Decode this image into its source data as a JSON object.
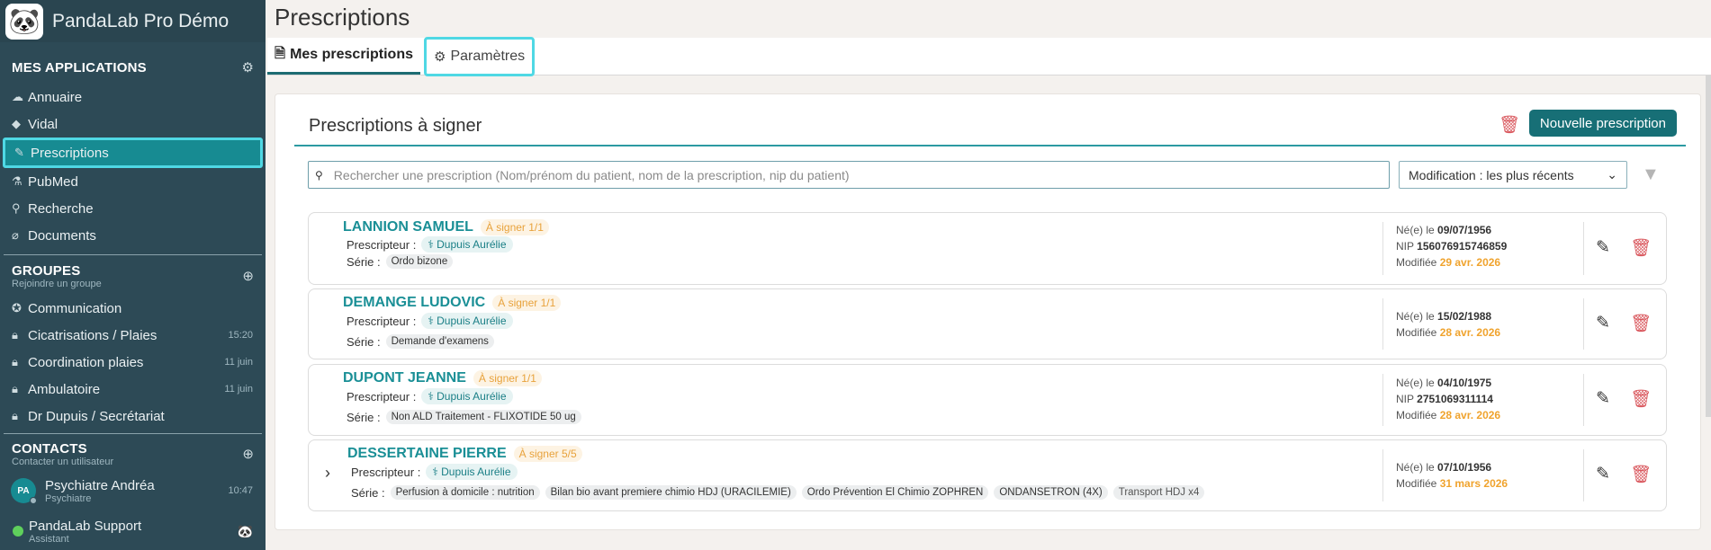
{
  "app": {
    "name": "PandaLab Pro Démo",
    "logo_icon": "panda-logo-icon"
  },
  "sidebar": {
    "apps_title": "MES APPLICATIONS",
    "apps": [
      {
        "label": "Annuaire",
        "icon": "cloud-icon"
      },
      {
        "label": "Vidal",
        "icon": "pill-icon"
      },
      {
        "label": "Prescriptions",
        "icon": "prescription-icon",
        "active": true
      },
      {
        "label": "PubMed",
        "icon": "pubmed-icon"
      },
      {
        "label": "Recherche",
        "icon": "search-icon"
      },
      {
        "label": "Documents",
        "icon": "paperclip-icon"
      }
    ],
    "groups_title": "GROUPES",
    "groups_sub": "Rejoindre un groupe",
    "groups": [
      {
        "label": "Communication",
        "time": ""
      },
      {
        "label": "Cicatrisations / Plaies",
        "time": "15:20"
      },
      {
        "label": "Coordination plaies",
        "time": "11 juin"
      },
      {
        "label": "Ambulatoire",
        "time": "11 juin"
      },
      {
        "label": "Dr Dupuis / Secrétariat",
        "time": ""
      }
    ],
    "contacts_title": "CONTACTS",
    "contacts_sub": "Contacter un utilisateur",
    "contacts": [
      {
        "initials": "PA",
        "name": "Psychiatre Andréa",
        "role": "Psychiatre",
        "time": "10:47"
      },
      {
        "initials": "",
        "name": "PandaLab Support",
        "role": "Assistant",
        "time": ""
      }
    ]
  },
  "page": {
    "title": "Prescriptions"
  },
  "tabs": [
    {
      "label": "Mes prescriptions"
    },
    {
      "label": "Paramètres"
    }
  ],
  "panel": {
    "title": "Prescriptions à signer",
    "new_button": "Nouvelle prescription",
    "search_placeholder": "Rechercher une prescription (Nom/prénom du patient, nom de la prescription, nip du patient)",
    "sort_value": "Modification : les plus récents"
  },
  "labels": {
    "prescripteur": "Prescripteur :",
    "serie": "Série :",
    "born": "Né(e) le",
    "nip": "NIP",
    "modified": "Modifiée"
  },
  "prescriptions": [
    {
      "name": "LANNION SAMUEL",
      "badge": "À signer 1/1",
      "doctor": "Dupuis Aurélie",
      "series": [
        "Ordo bizone"
      ],
      "born": "09/07/1956",
      "nip": "156076915746859",
      "modified": "29 avr. 2026"
    },
    {
      "name": "DEMANGE LUDOVIC",
      "badge": "À signer 1/1",
      "doctor": "Dupuis Aurélie",
      "series": [
        "Demande d'examens"
      ],
      "born": "15/02/1988",
      "nip": "",
      "modified": "28 avr. 2026"
    },
    {
      "name": "DUPONT JEANNE",
      "badge": "À signer 1/1",
      "doctor": "Dupuis Aurélie",
      "series": [
        "Non ALD Traitement - FLIXOTIDE 50 ug"
      ],
      "born": "04/10/1975",
      "nip": "2751069311114",
      "modified": "28 avr. 2026"
    },
    {
      "name": "DESSERTAINE PIERRE",
      "badge": "À signer 5/5",
      "doctor": "Dupuis Aurélie",
      "series": [
        "Perfusion à domicile : nutrition",
        "Bilan bio avant premiere chimio HDJ (URACILEMIE)",
        "Ordo Prévention El Chimio ZOPHREN",
        "ONDANSETRON (4X)",
        "Transport HDJ x4"
      ],
      "born": "07/10/1956",
      "nip": "",
      "modified": "31 mars 2026"
    }
  ],
  "colors": {
    "sidebar": "#2d4a56",
    "accent": "#178b92",
    "highlight": "#4fd8e4",
    "warning": "#f0a32d",
    "danger": "#d9575d"
  }
}
